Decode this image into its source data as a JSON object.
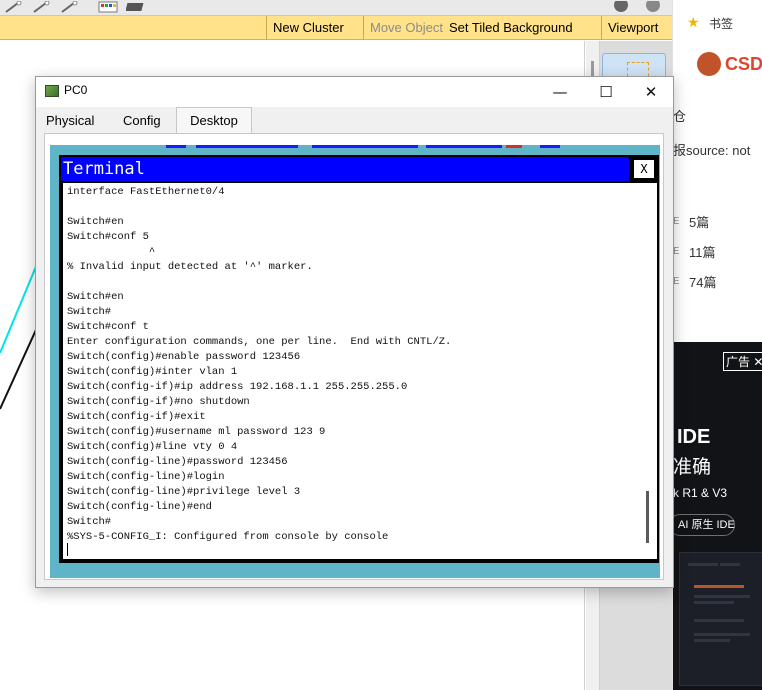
{
  "toolbar": {
    "new_cluster": "New Cluster",
    "move_object": "Move Object",
    "set_tiled_background": "Set Tiled Background",
    "viewport": "Viewport"
  },
  "window": {
    "title": "PC0",
    "minimize": "—",
    "maximize": "☐",
    "close": "✕",
    "tabs": [
      "Physical",
      "Config",
      "Desktop"
    ],
    "active_tab": "Desktop"
  },
  "terminal": {
    "title": "Terminal",
    "close_label": "X",
    "lines": [
      "interface FastEthernet0/4",
      "",
      "Switch#en",
      "Switch#conf 5",
      "             ^",
      "% Invalid input detected at '^' marker.",
      "",
      "Switch#en",
      "Switch#",
      "Switch#conf t",
      "Enter configuration commands, one per line.  End with CNTL/Z.",
      "Switch(config)#enable password 123456",
      "Switch(config)#inter vlan 1",
      "Switch(config-if)#ip address 192.168.1.1 255.255.255.0",
      "Switch(config-if)#no shutdown",
      "Switch(config-if)#exit",
      "Switch(config)#username ml password 123 9",
      "Switch(config)#line vty 0 4",
      "Switch(config-line)#password 123456",
      "Switch(config-line)#login",
      "Switch(config-line)#privilege level 3",
      "Switch(config-line)#end",
      "Switch#",
      "%SYS-5-CONFIG_I: Configured from console by console"
    ]
  },
  "browser_sidebar": {
    "bookmarks": "书签",
    "brand": "CSD",
    "text1": "仓",
    "text2": "报source: not",
    "count1": "5篇",
    "count2": "11篇",
    "count3": "74篇",
    "ad_tag": "广告",
    "ad_close": "✕",
    "ad_ide": "IDE",
    "ad_accurate": "准确",
    "ad_models": "k R1 & V3",
    "ad_pill": "AI 原生 IDE"
  },
  "colors": {
    "toolbar_bg": "#ffe28a",
    "terminal_title_bg": "#0000ff",
    "desktop_bg": "#5fb4c8",
    "brand_red": "#e0442a"
  }
}
